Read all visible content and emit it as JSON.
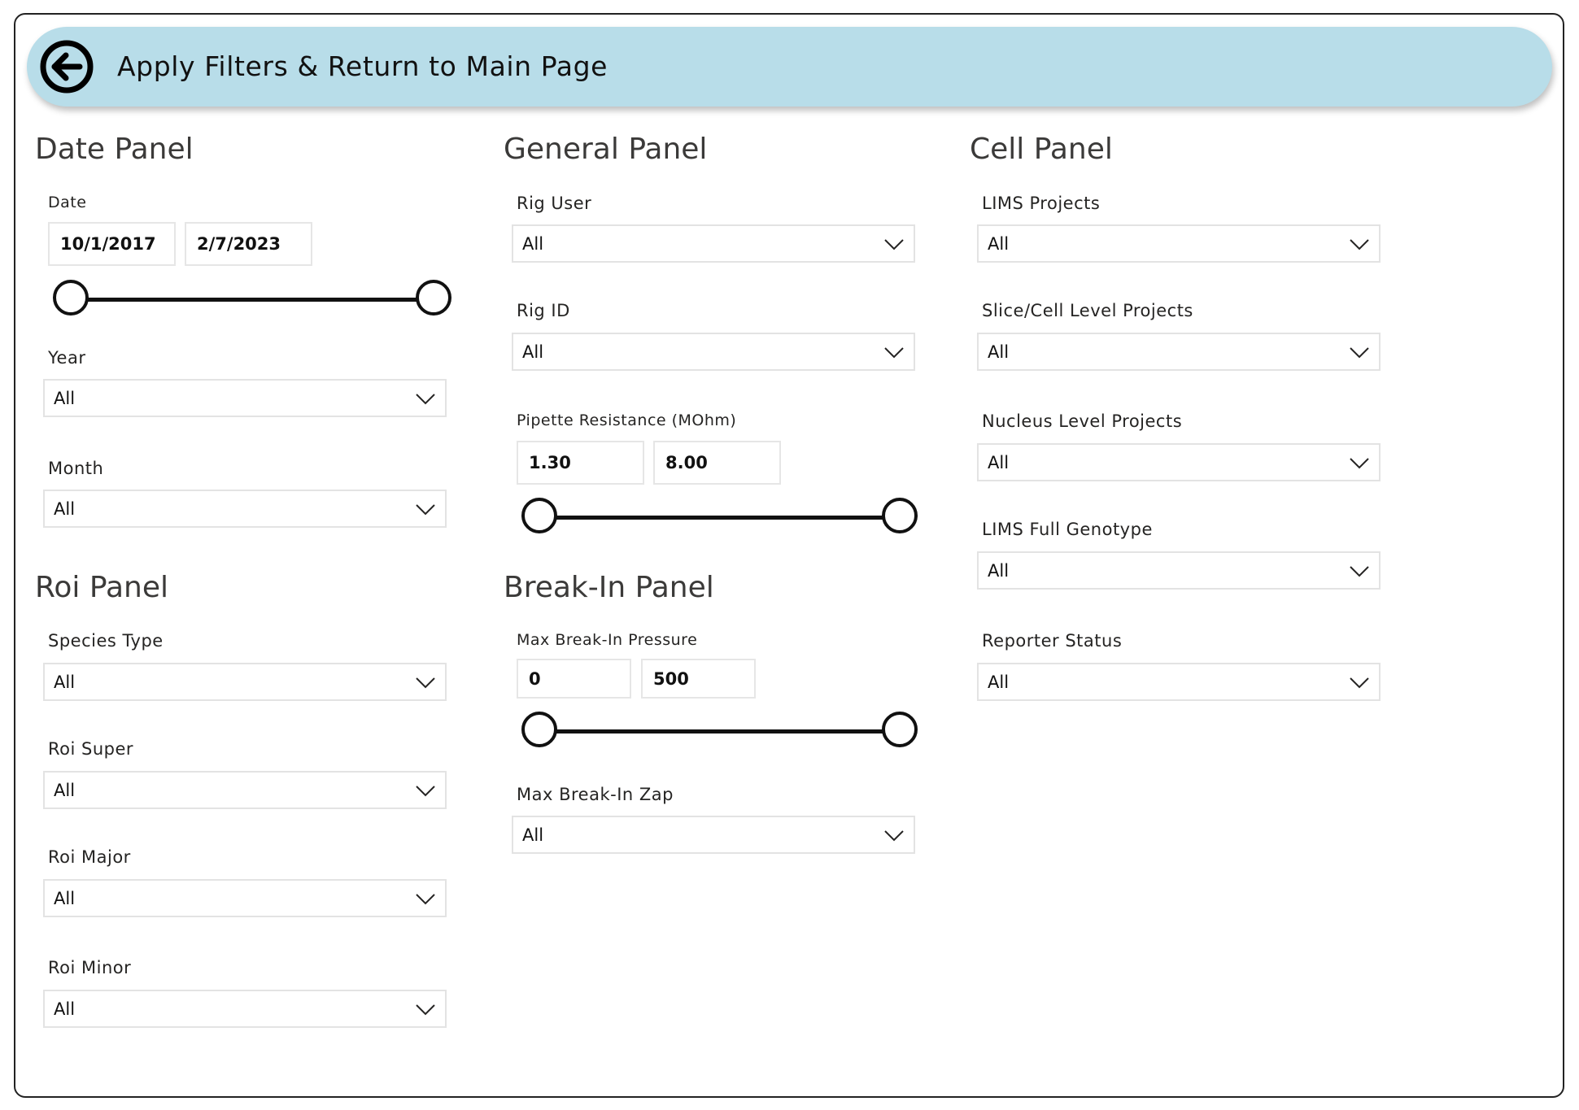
{
  "header": {
    "title": "Apply Filters & Return to Main Page",
    "icon": "back-arrow-icon"
  },
  "date_panel": {
    "title": "Date Panel",
    "date": {
      "label": "Date",
      "start": "10/1/2017",
      "end": "2/7/2023"
    },
    "year": {
      "label": "Year",
      "value": "All"
    },
    "month": {
      "label": "Month",
      "value": "All"
    }
  },
  "roi_panel": {
    "title": "Roi Panel",
    "species_type": {
      "label": "Species Type",
      "value": "All"
    },
    "roi_super": {
      "label": "Roi Super",
      "value": "All"
    },
    "roi_major": {
      "label": "Roi Major",
      "value": "All"
    },
    "roi_minor": {
      "label": "Roi Minor",
      "value": "All"
    }
  },
  "general_panel": {
    "title": "General Panel",
    "rig_user": {
      "label": "Rig User",
      "value": "All"
    },
    "rig_id": {
      "label": "Rig ID",
      "value": "All"
    },
    "pipette_resistance": {
      "label": "Pipette Resistance (MOhm)",
      "min": "1.30",
      "max": "8.00"
    }
  },
  "breakin_panel": {
    "title": "Break-In Panel",
    "max_pressure": {
      "label": "Max Break-In Pressure",
      "min": "0",
      "max": "500"
    },
    "max_zap": {
      "label": "Max Break-In Zap",
      "value": "All"
    }
  },
  "cell_panel": {
    "title": "Cell Panel",
    "lims_projects": {
      "label": "LIMS Projects",
      "value": "All"
    },
    "slice_cell_projects": {
      "label": "Slice/Cell Level Projects",
      "value": "All"
    },
    "nucleus_projects": {
      "label": "Nucleus Level Projects",
      "value": "All"
    },
    "lims_genotype": {
      "label": "LIMS Full Genotype",
      "value": "All"
    },
    "reporter_status": {
      "label": "Reporter Status",
      "value": "All"
    }
  },
  "colors": {
    "header_bg": "#b8dde9",
    "border": "#222222",
    "dropdown_border": "#e3e3e3"
  }
}
